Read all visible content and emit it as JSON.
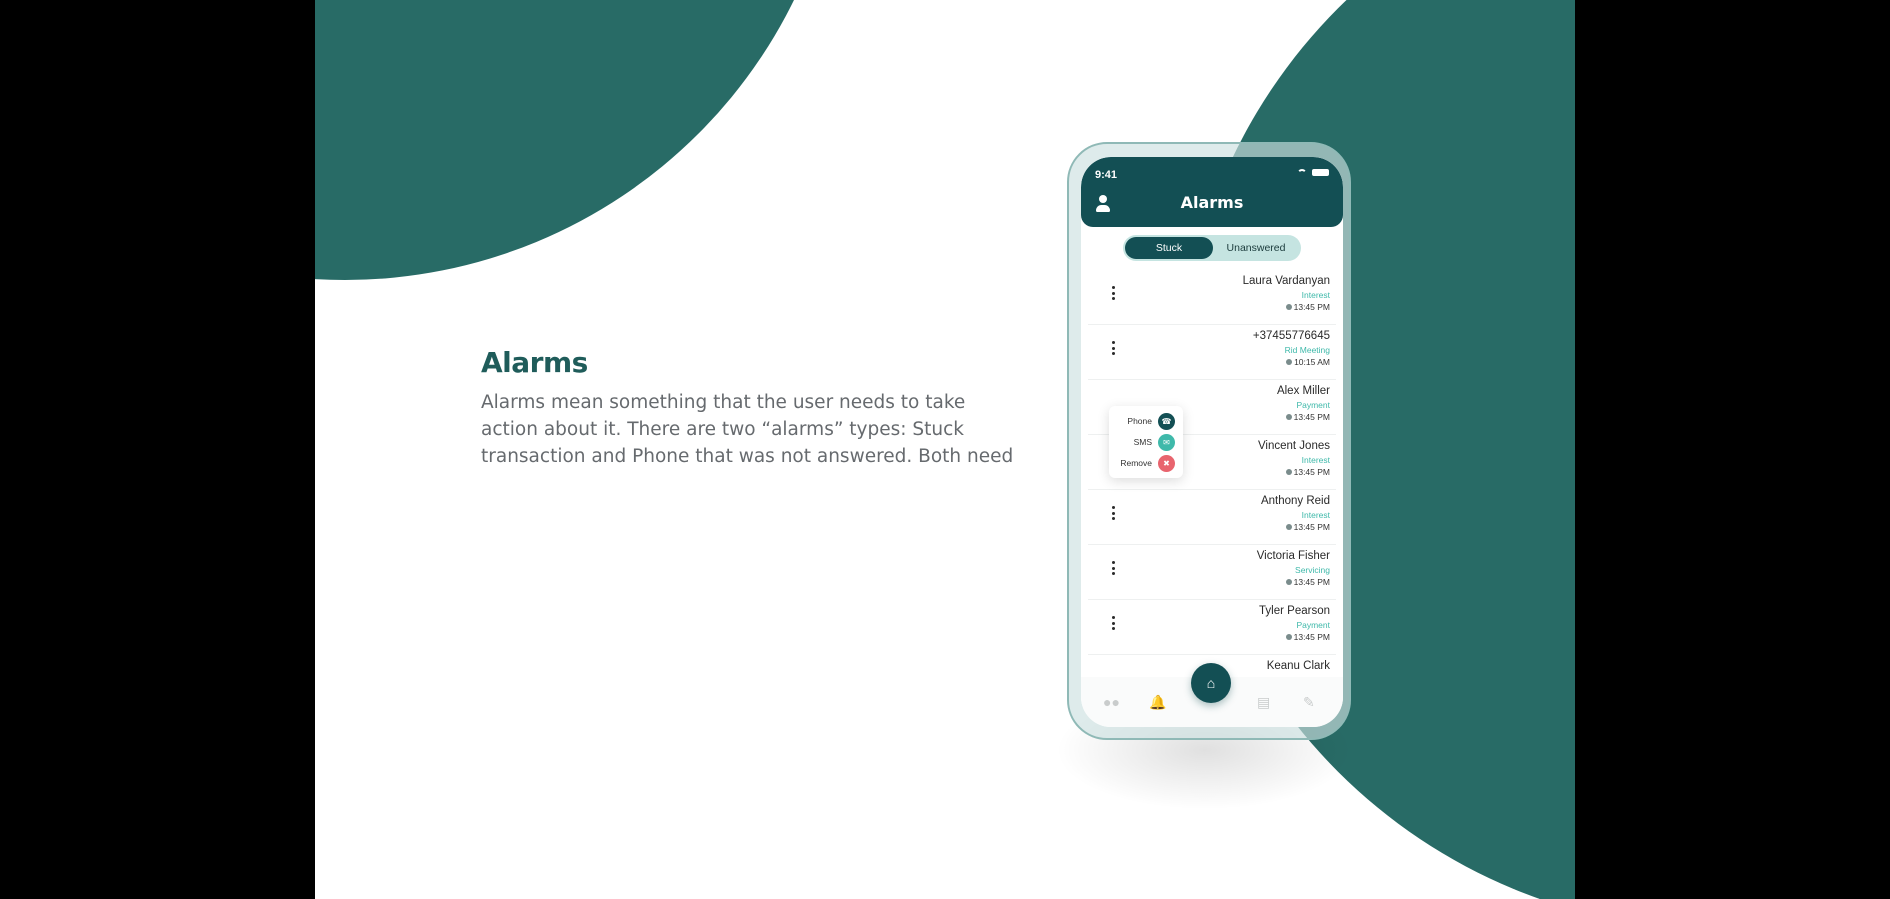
{
  "slide": {
    "heading": "Alarms",
    "description": "Alarms mean something that the user needs to take action about it. There are two “alarms” types: Stuck transaction and Phone that was not answered. Both need"
  },
  "phone": {
    "status_time": "9:41",
    "title": "Alarms",
    "tabs": {
      "stuck": "Stuck",
      "unanswered": "Unanswered",
      "active": "Stuck"
    },
    "alarms": [
      {
        "name": "Laura Vardanyan",
        "type": "Interest",
        "time": "13:45 PM"
      },
      {
        "name": "+37455776645",
        "type": "Rid Meeting",
        "time": "10:15 AM"
      },
      {
        "name": "Alex Miller",
        "type": "Payment",
        "time": "13:45 PM"
      },
      {
        "name": "Vincent Jones",
        "type": "Interest",
        "time": "13:45 PM"
      },
      {
        "name": "Anthony Reid",
        "type": "Interest",
        "time": "13:45 PM"
      },
      {
        "name": "Victoria Fisher",
        "type": "Servicing",
        "time": "13:45 PM"
      },
      {
        "name": "Tyler Pearson",
        "type": "Payment",
        "time": "13:45 PM"
      },
      {
        "name": "Keanu Clark",
        "type": "",
        "time": ""
      }
    ],
    "context_menu": {
      "phone": "Phone",
      "sms": "SMS",
      "remove": "Remove"
    },
    "nav": {
      "items": [
        "users-icon",
        "bell-icon",
        "home-icon",
        "chart-icon",
        "edit-icon"
      ],
      "active": "bell-icon"
    }
  },
  "colors": {
    "brand": "#134f54",
    "accent": "#3fb9aa",
    "background_shape": "#286b66",
    "remove": "#e8646e"
  }
}
